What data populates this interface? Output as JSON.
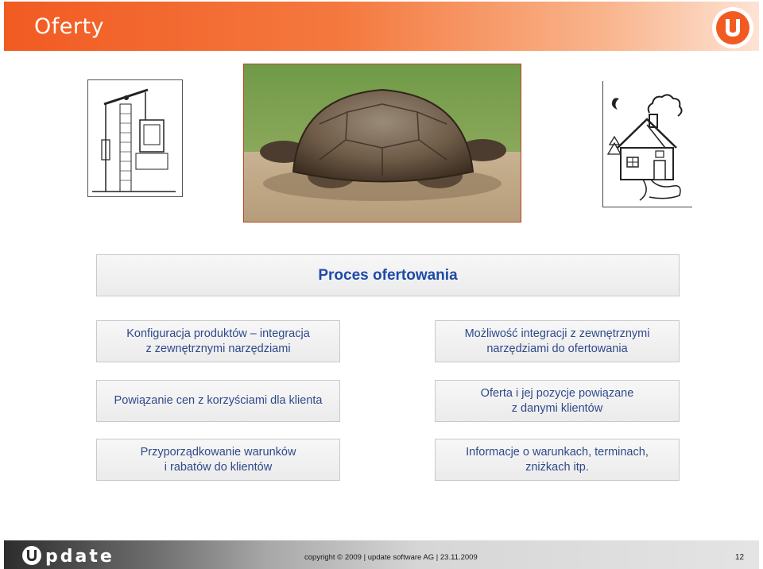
{
  "header": {
    "title": "Oferty",
    "logo_alt": "uptime logo",
    "colors": {
      "accent": "#f15b22"
    }
  },
  "images": {
    "pump": "oil-pump-drawing",
    "turtle": "giant-tortoise-photo",
    "house": "house-drawing"
  },
  "process": {
    "title": "Proces ofertowania",
    "left": [
      "Konfiguracja produktów – integracja\nz zewnętrznymi narzędziami",
      "Powiązanie cen z korzyściami dla klienta",
      "Przyporządkowanie warunków\ni rabatów do klientów"
    ],
    "right": [
      "Możliwość integracji z zewnętrznymi\nnarzędziami do ofertowania",
      "Oferta i jej pozycje powiązane\nz danymi klientów",
      "Informacje o warunkach, terminach,\nzniżkach itp."
    ]
  },
  "footer": {
    "copyright": "copyright © 2009 | update software AG | 23.11.2009",
    "page_number": "12"
  }
}
